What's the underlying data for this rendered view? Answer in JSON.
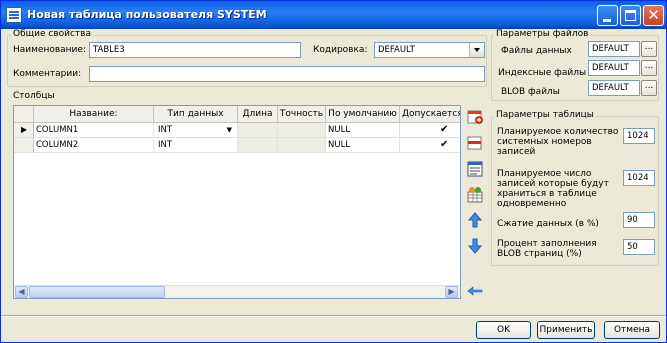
{
  "window": {
    "title": "Новая таблица пользователя SYSTEM"
  },
  "general": {
    "legend": "Общие свойства",
    "name_label": "Наименование:",
    "name_value": "TABLE3",
    "encoding_label": "Кодировка:",
    "encoding_value": "DEFAULT",
    "comment_label": "Комментарии:",
    "comment_value": ""
  },
  "columns": {
    "label": "Столбцы",
    "headers": [
      "Название:",
      "Тип данных",
      "Длина",
      "Точность",
      "По умолчанию",
      "Допускается N"
    ],
    "rows": [
      {
        "name": "COLUMN1",
        "type": "INT",
        "length": "",
        "precision": "",
        "default": "NULL",
        "nullable": "✔"
      },
      {
        "name": "COLUMN2",
        "type": "INT",
        "length": "",
        "precision": "",
        "default": "NULL",
        "nullable": "✔"
      }
    ]
  },
  "files": {
    "legend": "Параметры файлов",
    "data_label": "Файлы данных",
    "data_value": "DEFAULT",
    "index_label": "Индексные файлы",
    "index_value": "DEFAULT",
    "blob_label": "BLOB файлы",
    "blob_value": "DEFAULT",
    "browse": "..."
  },
  "table_params": {
    "legend": "Параметры таблицы",
    "sys_rows_label": [
      "Планируемое количество",
      "системных номеров",
      "записей"
    ],
    "sys_rows_value": "1024",
    "concurrent_label": [
      "Планируемое число",
      "записей которые будут",
      "храниться в таблице",
      "одновременно"
    ],
    "concurrent_value": "1024",
    "compression_label": "Сжатие данных (в %)",
    "compression_value": "90",
    "blob_fill_label": [
      "Процент заполнения",
      "BLOB страниц (%)"
    ],
    "blob_fill_value": "50"
  },
  "buttons": {
    "ok": "OK",
    "apply": "Применить",
    "cancel": "Отмена"
  },
  "colors": {
    "titlebar": "#0A5FE8",
    "dialog": "#ECE9D8",
    "input_border": "#7F9DB9"
  },
  "icons": [
    "app-icon",
    "minimize-icon",
    "maximize-icon",
    "close-icon",
    "add-column-icon",
    "delete-column-icon",
    "properties-icon",
    "index-icon",
    "move-up-icon",
    "move-down-icon",
    "back-icon"
  ]
}
